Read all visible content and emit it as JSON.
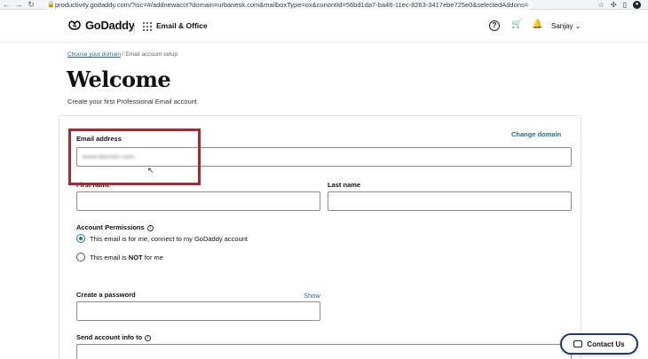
{
  "browser": {
    "back": "←",
    "forward": "→",
    "reload": "↻",
    "url": "productivity.godaddy.com/?isc=#/addnewacct?domain=urbanesk.com&mailboxType=ox&conontId=56bd1da7-ba46-11ec-8263-3417ebe725e0&selectedAddons="
  },
  "header": {
    "logo_text": "GoDaddy",
    "product_name": "Email & Office",
    "user_label": "Sanjay ⌄"
  },
  "breadcrumb": {
    "link": "Choose your domain",
    "separator": "/",
    "current": "Email account setup"
  },
  "page": {
    "title": "Welcome",
    "subtitle": "Create your first Professional Email account"
  },
  "form": {
    "email_label": "Email address",
    "change_domain": "Change domain",
    "email_value": "www.domain.com",
    "first_name_label": "First name",
    "last_name_label": "Last name",
    "first_name_value": "",
    "last_name_value": "",
    "permissions_label": "Account Permissions",
    "radio_me": "This email is for me, connect to my GoDaddy account",
    "radio_not_prefix": "This email is",
    "radio_not_bold": "NOT",
    "radio_not_suffix": "for me",
    "password_label": "Create a password",
    "show_label": "Show",
    "send_info_label": "Send account info to"
  },
  "contact": {
    "label": "Contact Us"
  },
  "colors": {
    "accent_teal": "#1f6f8b",
    "highlight_red": "#b2242e",
    "contact_border": "#1f3a6b"
  }
}
